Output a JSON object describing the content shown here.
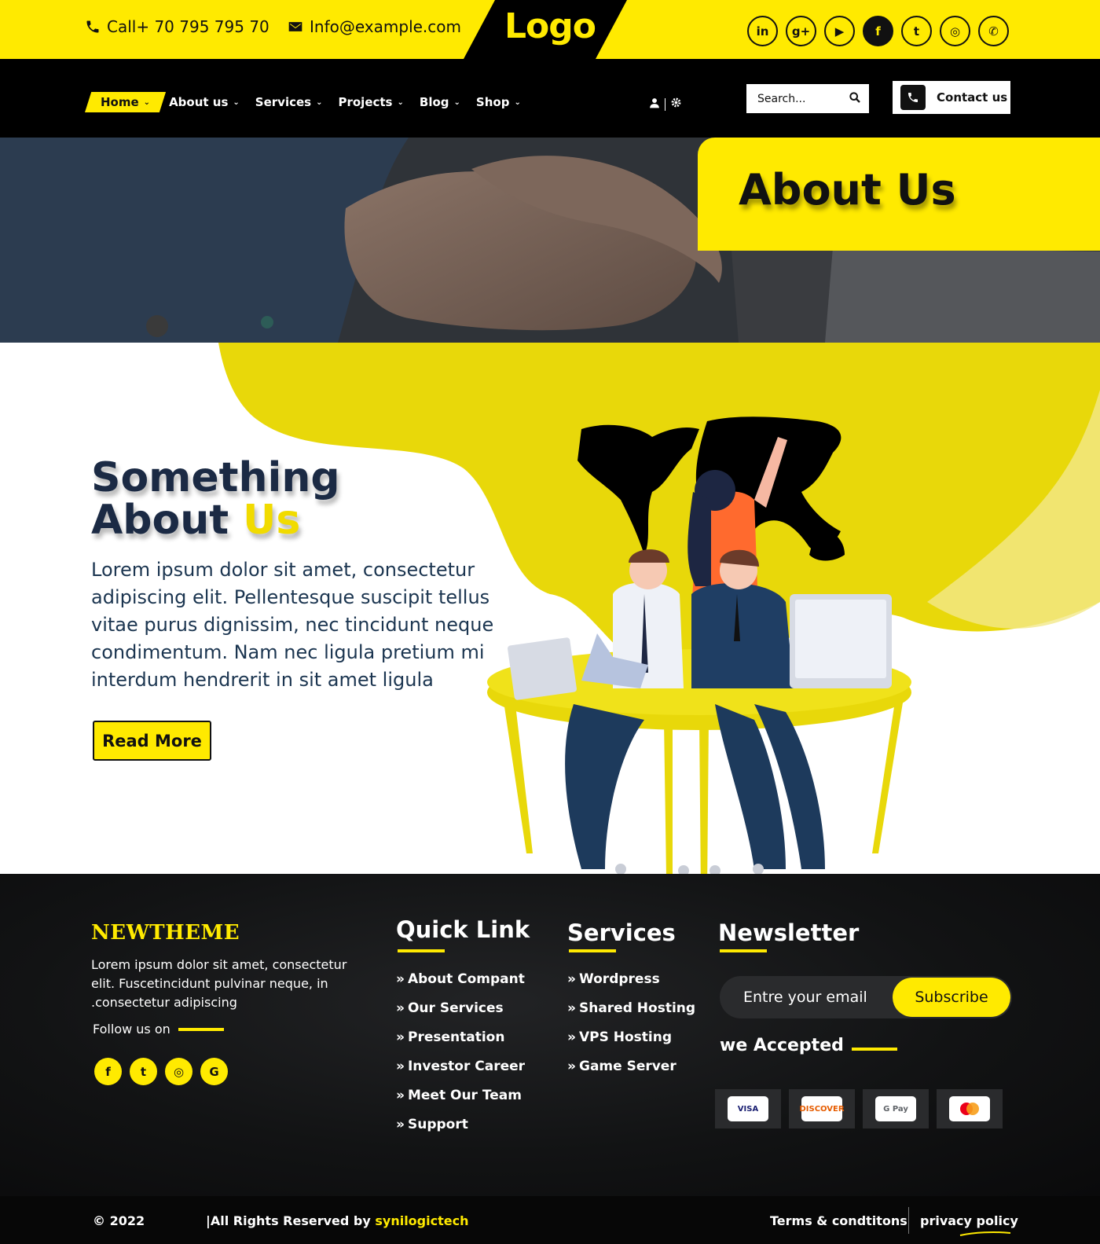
{
  "topbar": {
    "phone": "Call+ 70 795 795 70",
    "email": "Info@example.com",
    "logo": "Logo",
    "socials": [
      {
        "icon": "linkedin-icon",
        "glyph": "in"
      },
      {
        "icon": "google-plus-icon",
        "glyph": "g+"
      },
      {
        "icon": "youtube-icon",
        "glyph": "▶"
      },
      {
        "icon": "facebook-icon",
        "glyph": "f"
      },
      {
        "icon": "twitter-icon",
        "glyph": "t"
      },
      {
        "icon": "instagram-icon",
        "glyph": "◎"
      },
      {
        "icon": "whatsapp-icon",
        "glyph": "✆"
      }
    ]
  },
  "nav": {
    "items": [
      {
        "label": "Home",
        "active": true
      },
      {
        "label": "About us"
      },
      {
        "label": "Services"
      },
      {
        "label": "Projects"
      },
      {
        "label": "Blog"
      },
      {
        "label": "Shop"
      }
    ],
    "chevron": "⌄",
    "search_placeholder": "Search...",
    "contact_label": "Contact us"
  },
  "hero": {
    "title": "About Us"
  },
  "about": {
    "heading_line1": "Something",
    "heading_line2_a": "About ",
    "heading_line2_b": "Us",
    "text": "Lorem ipsum dolor sit amet, consectetur adipiscing elit. Pellentesque suscipit tellus vitae purus dignissim, nec tincidunt neque condimentum. Nam nec ligula pretium mi interdum hendrerit in sit amet ligula",
    "button": "Read More"
  },
  "footer": {
    "brand": "NEWTHEME",
    "description": "Lorem ipsum dolor sit amet, consectetur  elit. Fuscetincidunt pulvinar neque, in .consectetur adipiscing",
    "follow": "Follow us on",
    "socials": [
      {
        "icon": "facebook-icon",
        "glyph": "f"
      },
      {
        "icon": "twitter-icon",
        "glyph": "t"
      },
      {
        "icon": "instagram-icon",
        "glyph": "◎"
      },
      {
        "icon": "google-icon",
        "glyph": "G"
      }
    ],
    "quick_link": {
      "title": "Quick Link",
      "items": [
        "About Compant",
        "Our Services",
        "Presentation",
        "Investor Career",
        "Meet Our Team",
        "Support"
      ]
    },
    "services": {
      "title": "Services",
      "items": [
        "Wordpress",
        "Shared Hosting",
        "VPS Hosting",
        "Game Server"
      ]
    },
    "newsletter": {
      "title": "Newsletter",
      "email_placeholder": "Entre your email",
      "subscribe": "Subscribe",
      "accepted": "we Accepted",
      "cards": [
        {
          "name": "VISA",
          "icon": "visa-icon",
          "color": "#1a1f71"
        },
        {
          "name": "DISCOVER",
          "icon": "discover-icon",
          "color": "#e65c00"
        },
        {
          "name": "G Pay",
          "icon": "gpay-icon",
          "color": "#5f6368"
        },
        {
          "name": "",
          "icon": "mastercard-icon",
          "color": "#eb001b"
        }
      ]
    }
  },
  "bottom": {
    "copyright": "© 2022",
    "rights_prefix": "|All Rights Reserved by ",
    "rights_brand": "synilogictech",
    "terms": "Terms & condtitons",
    "privacy": "privacy policy"
  },
  "colors": {
    "accent": "#ffea00",
    "dark": "#000000",
    "heading": "#1b2a44"
  }
}
